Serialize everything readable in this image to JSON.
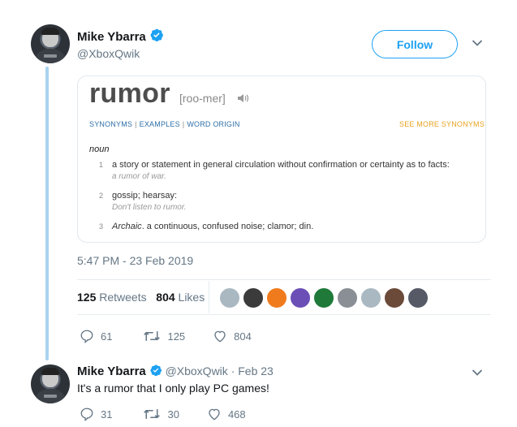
{
  "tweet": {
    "author_name": "Mike Ybarra",
    "author_handle": "@XboxQwik",
    "follow_label": "Follow",
    "timestamp": "5:47 PM - 23 Feb 2019",
    "retweets_count": "125",
    "retweets_label": "Retweets",
    "likes_count": "804",
    "likes_label": "Likes",
    "actions": {
      "reply": "61",
      "retweet": "125",
      "like": "804"
    }
  },
  "card": {
    "word": "rumor",
    "pronunciation": "[roo-mer]",
    "links": [
      "SYNONYMS",
      "EXAMPLES",
      "WORD ORIGIN"
    ],
    "see_more": "SEE MORE SYNONYMS F",
    "part_of_speech": "noun",
    "definitions": [
      {
        "num": "1",
        "text": "a story or statement in general circulation without confirmation or certainty as to facts:",
        "example": "a rumor of war."
      },
      {
        "num": "2",
        "text": "gossip; hearsay:",
        "example": "Don't listen to rumor."
      },
      {
        "num": "3",
        "label": "Archaic",
        "text": ". a continuous, confused noise; clamor; din."
      }
    ]
  },
  "likers": [
    {
      "icon": "default-avatar",
      "color": "#aab8c2"
    },
    {
      "icon": "dark-avatar",
      "color": "#3b3b3b"
    },
    {
      "icon": "fg-avatar",
      "color": "#f07b1d"
    },
    {
      "icon": "colorful-avatar",
      "color": "#6b4fb6"
    },
    {
      "icon": "green-avatar",
      "color": "#1f7a3a"
    },
    {
      "icon": "grey-avatar",
      "color": "#8a8f95"
    },
    {
      "icon": "default-avatar",
      "color": "#aab8c2"
    },
    {
      "icon": "dark-avatar",
      "color": "#6b4a3a"
    },
    {
      "icon": "mixed-avatar",
      "color": "#555a66"
    }
  ],
  "reply": {
    "author_name": "Mike Ybarra",
    "author_handle": "@XboxQwik",
    "date": "· Feb 23",
    "text": "It's a rumor that I only play PC games!",
    "actions": {
      "reply": "31",
      "retweet": "30",
      "like": "468"
    }
  },
  "colors": {
    "accent": "#1da1f2",
    "thread": "#a8d3f0",
    "link": "#2e6fa8",
    "see_more": "#e6a321"
  }
}
